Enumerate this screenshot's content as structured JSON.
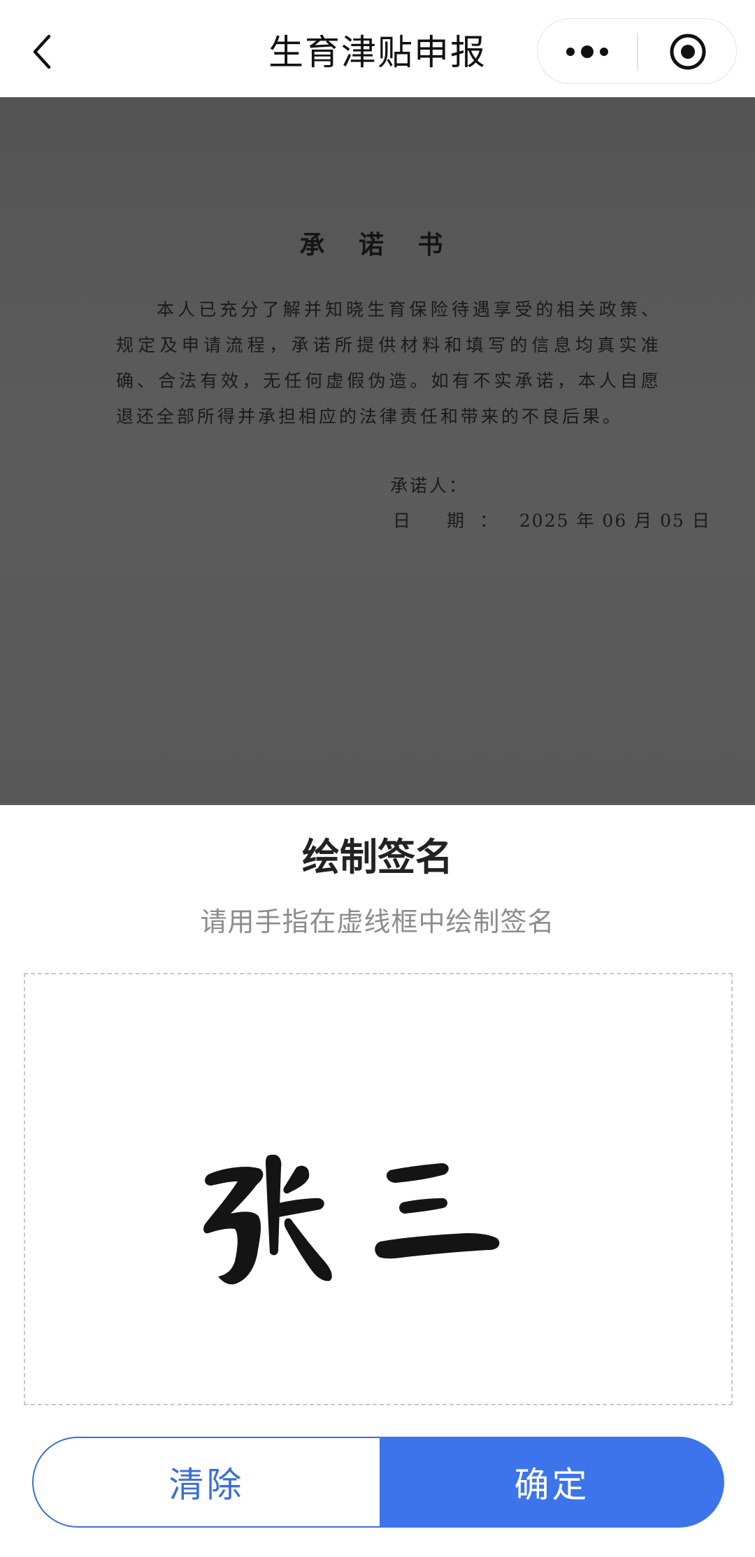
{
  "navbar": {
    "back_icon": "chevron-left-icon",
    "title": "生育津贴申报",
    "more_icon": "more-dots-icon",
    "target_icon": "target-circle-icon"
  },
  "document": {
    "title": "承 诺 书",
    "body": "本人已充分了解并知晓生育保险待遇享受的相关政策、规定及申请流程，承诺所提供材料和填写的信息均真实准确、合法有效，无任何虚假伪造。如有不实承诺，本人自愿退还全部所得并承担相应的法律责任和带来的不良后果。",
    "pledger_label": "承诺人：",
    "date_label": "日 期：",
    "date_value": "2025 年 06 月 05 日"
  },
  "sign_panel": {
    "title": "绘制签名",
    "subtitle": "请用手指在虚线框中绘制签名",
    "signature_text": "张 三",
    "clear_label": "清除",
    "confirm_label": "确定"
  },
  "colors": {
    "accent": "#3d74eb",
    "overlay": "#5a5a5a"
  }
}
